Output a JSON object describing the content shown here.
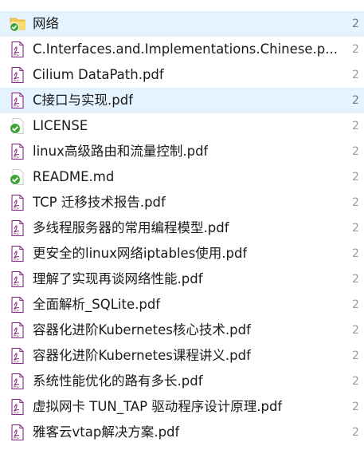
{
  "files": [
    {
      "name": "网络",
      "type": "folder",
      "selected": true,
      "col2": "2"
    },
    {
      "name": "C.Interfaces.and.Implementations.Chinese.p...",
      "type": "pdf",
      "selected": false,
      "col2": "2"
    },
    {
      "name": "Cilium DataPath.pdf",
      "type": "pdf",
      "selected": false,
      "col2": "2"
    },
    {
      "name": "C接口与实现.pdf",
      "type": "pdf",
      "selected": true,
      "col2": "2"
    },
    {
      "name": "LICENSE",
      "type": "file-synced",
      "selected": false,
      "col2": "2"
    },
    {
      "name": "linux高级路由和流量控制.pdf",
      "type": "pdf",
      "selected": false,
      "col2": "2"
    },
    {
      "name": "README.md",
      "type": "file-synced",
      "selected": false,
      "col2": "2"
    },
    {
      "name": "TCP 迁移技术报告.pdf",
      "type": "pdf",
      "selected": false,
      "col2": "2"
    },
    {
      "name": "多线程服务器的常用编程模型.pdf",
      "type": "pdf",
      "selected": false,
      "col2": "2"
    },
    {
      "name": "更安全的linux网络iptables使用.pdf",
      "type": "pdf",
      "selected": false,
      "col2": "2"
    },
    {
      "name": "理解了实现再谈网络性能.pdf",
      "type": "pdf",
      "selected": false,
      "col2": "2"
    },
    {
      "name": "全面解析_SQLite.pdf",
      "type": "pdf",
      "selected": false,
      "col2": "2"
    },
    {
      "name": "容器化进阶Kubernetes核心技术.pdf",
      "type": "pdf",
      "selected": false,
      "col2": "2"
    },
    {
      "name": "容器化进阶Kubernetes课程讲义.pdf",
      "type": "pdf",
      "selected": false,
      "col2": "2"
    },
    {
      "name": "系统性能优化的路有多长.pdf",
      "type": "pdf",
      "selected": false,
      "col2": "2"
    },
    {
      "name": "虚拟网卡 TUN_TAP 驱动程序设计原理.pdf",
      "type": "pdf",
      "selected": false,
      "col2": "2"
    },
    {
      "name": "雅客云vtap解决方案.pdf",
      "type": "pdf",
      "selected": false,
      "col2": "2"
    }
  ],
  "colors": {
    "selection": "#e5f3ff",
    "pdf_accent": "#8b2a86",
    "sync_green": "#3ea33a",
    "folder_yellow": "#f3c84b"
  }
}
